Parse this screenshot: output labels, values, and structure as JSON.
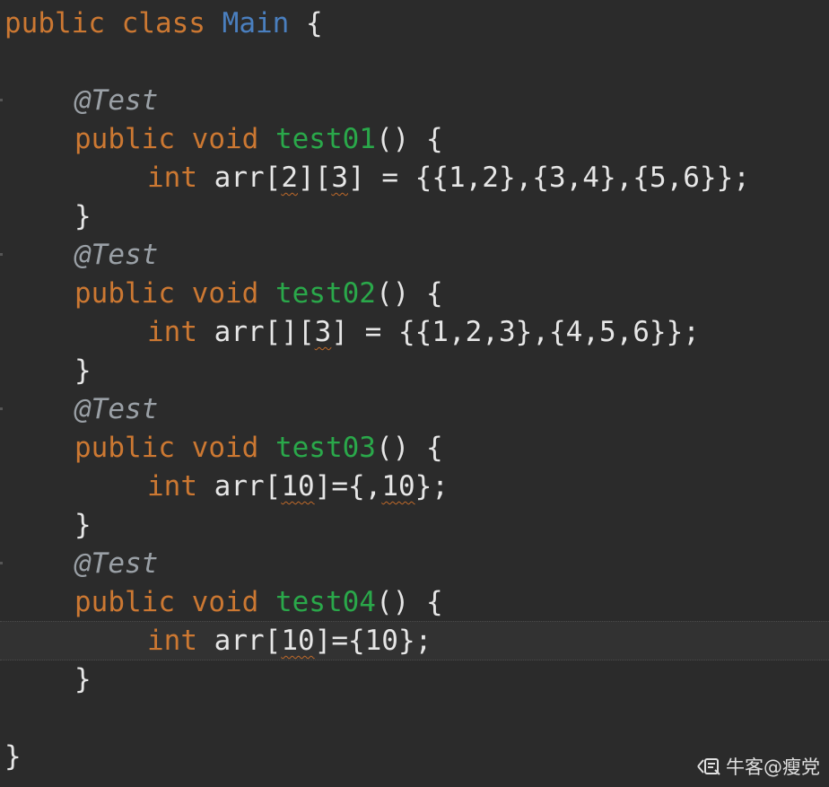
{
  "code": {
    "line1": {
      "kw_public": "public",
      "kw_class": "class",
      "classname": "Main",
      "brace": "{"
    },
    "test01": {
      "annotation": "@Test",
      "kw_public": "public",
      "kw_void": "void",
      "name": "test01",
      "sig_tail": "() {",
      "body_type": "int",
      "body_pre": "arr[",
      "dim1": "2",
      "mid": "][",
      "dim2": "3",
      "body_post": "] = {{1,2},{3,4},{5,6}};",
      "close": "}"
    },
    "test02": {
      "annotation": "@Test",
      "kw_public": "public",
      "kw_void": "void",
      "name": "test02",
      "sig_tail": "() {",
      "body_type": "int",
      "body_pre": "arr[][",
      "dim2": "3",
      "body_post": "] = {{1,2,3},{4,5,6}};",
      "close": "}"
    },
    "test03": {
      "annotation": "@Test",
      "kw_public": "public",
      "kw_void": "void",
      "name": "test03",
      "sig_tail": "() {",
      "body_type": "int",
      "body_pre": "arr[",
      "dim": "10",
      "mid": "]={,",
      "val": "10",
      "body_post": "};",
      "close": "}"
    },
    "test04": {
      "annotation": "@Test",
      "kw_public": "public",
      "kw_void": "void",
      "name": "test04",
      "sig_tail": "() {",
      "body_type": "int",
      "body_pre": "arr[",
      "dim": "10",
      "body_post": "]={10};",
      "close": "}"
    },
    "class_close": "}"
  },
  "watermark": {
    "text": "牛客@瘦党",
    "icon": "nowcoder-logo-icon"
  },
  "colors": {
    "background": "#2b2b2b",
    "keyword": "#cc7832",
    "classname": "#4a7fbf",
    "method": "#2aa84a",
    "annotation": "#9aa0a6",
    "text": "#e6e6e6"
  }
}
